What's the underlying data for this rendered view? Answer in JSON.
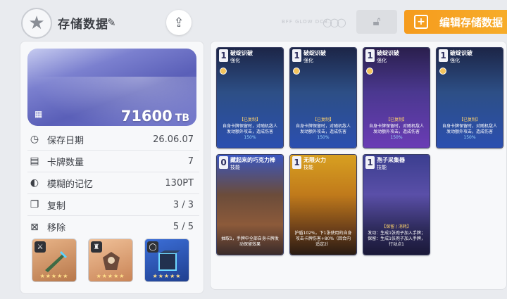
{
  "header": {
    "title": "存储数据",
    "faint_label": "BFF GLOW DCB..",
    "edit_button_label": "编辑存储数据",
    "icons": {
      "emblem": "star-badge-icon",
      "edit": "pencil-icon",
      "share": "share-icon",
      "lock": "unlock-icon",
      "edit_button": "plus-square-icon"
    }
  },
  "storage": {
    "amount": "71600",
    "unit": "TB"
  },
  "stats": [
    {
      "icon": "clock-icon",
      "label": "保存日期",
      "value": "26.06.07"
    },
    {
      "icon": "cards-icon",
      "label": "卡牌数量",
      "value": "7"
    },
    {
      "icon": "brain-icon",
      "label": "模糊的记忆",
      "value": "130PT"
    },
    {
      "icon": "copy-icon",
      "label": "复制",
      "value": "3 / 3"
    },
    {
      "icon": "remove-icon",
      "label": "移除",
      "value": "5 / 5"
    }
  ],
  "equipment": [
    {
      "name": "weapon",
      "badge_icon": "sword-icon",
      "stars": "★★★★★",
      "accent": "#c98b5a"
    },
    {
      "name": "armor",
      "badge_icon": "armor-icon",
      "stars": "★★★★★",
      "accent": "#d99a6b"
    },
    {
      "name": "relic",
      "badge_icon": "ring-icon",
      "stars": "★★★★★",
      "accent": "#2f62c8"
    }
  ],
  "cards": [
    {
      "cost": "1",
      "name": "破绽识破",
      "type": "强化",
      "tag": "【已复制】",
      "desc_before": "自身卡牌保留时，对随机敌人发动额外攻击，造成伤害",
      "desc_value": "150%",
      "color": "#2b4fb0"
    },
    {
      "cost": "1",
      "name": "破绽识破",
      "type": "强化",
      "tag": "【已复制】",
      "desc_before": "自身卡牌保留时，对随机敌人发动额外攻击，造成伤害",
      "desc_value": "150%",
      "color": "#2b4fb0"
    },
    {
      "cost": "1",
      "name": "破绽识破",
      "type": "强化",
      "tag": "【已复制】",
      "desc_before": "自身卡牌保留时，对随机敌人发动额外攻击，造成伤害",
      "desc_value": "150%",
      "color": "#6a3cb5"
    },
    {
      "cost": "1",
      "name": "破绽识破",
      "type": "强化",
      "tag": "【已复制】",
      "desc_before": "自身卡牌保留时，对随机敌人发动额外攻击，造成伤害",
      "desc_value": "150%",
      "color": "#2b4fb0"
    },
    {
      "cost": "0",
      "name": "藏起来的巧克力棒",
      "type": "技能",
      "tag": "",
      "desc_before": "抽取1，手牌中全部自身卡牌发动保留效果",
      "desc_value": "",
      "color": "#3a56c0"
    },
    {
      "cost": "1",
      "name": "无限火力",
      "type": "技能",
      "tag": "",
      "desc_before": "护盾102%，下1张使用的自身攻击卡牌伤害+80%（回合内适定2）",
      "desc_value": "",
      "color": "#d8a021"
    },
    {
      "cost": "1",
      "name": "孢子采集器",
      "type": "技能",
      "tag": "【保留 / 消耗】",
      "desc_before": "发动：生成1张孢子加入手牌；保留：生成1张孢子加入手牌，行动点1",
      "desc_value": "",
      "color": "#3b3e8f"
    }
  ]
}
